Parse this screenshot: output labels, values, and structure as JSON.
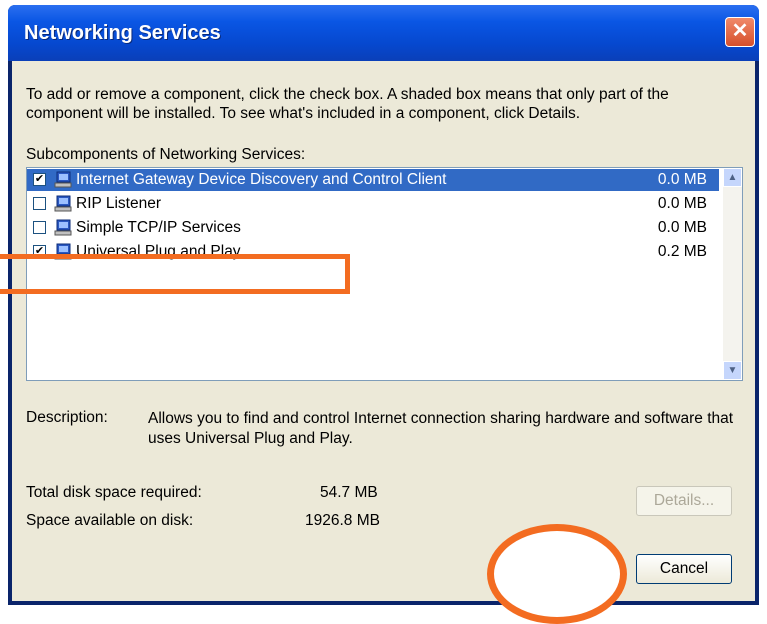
{
  "window": {
    "title": "Networking Services",
    "close_glyph": "✕"
  },
  "intro_text": "To add or remove a component, click the check box. A shaded box means that only part of the component will be installed. To see what's included in a component, click Details.",
  "list_label": "Subcomponents of Networking Services:",
  "components": [
    {
      "name": "Internet Gateway Device Discovery and Control Client",
      "size": "0.0 MB",
      "checked": true,
      "selected": true
    },
    {
      "name": "RIP Listener",
      "size": "0.0 MB",
      "checked": false,
      "selected": false
    },
    {
      "name": "Simple TCP/IP Services",
      "size": "0.0 MB",
      "checked": false,
      "selected": false
    },
    {
      "name": "Universal Plug and Play",
      "size": "0.2 MB",
      "checked": true,
      "selected": false
    }
  ],
  "description": {
    "label": "Description:",
    "text": "Allows you to find and control Internet connection sharing hardware and software that uses Universal Plug and Play."
  },
  "disk": {
    "required_label": "Total disk space required:",
    "required_value": "54.7 MB",
    "available_label": "Space available on disk:",
    "available_value": "1926.8 MB"
  },
  "buttons": {
    "details": "Details...",
    "cancel": "Cancel"
  },
  "scrollbar": {
    "up": "▲",
    "down": "▼"
  },
  "colors": {
    "highlight": "#f36c21",
    "selection": "#316ac5",
    "titlebar": "#0a56e4"
  }
}
